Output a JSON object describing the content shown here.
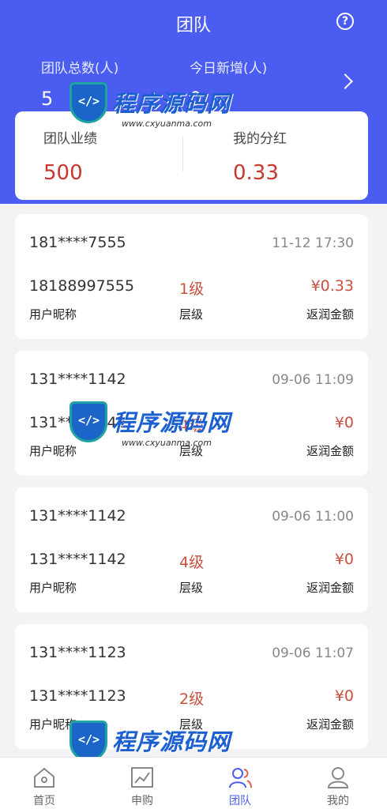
{
  "header": {
    "title": "团队",
    "help_icon": "question-circle-icon"
  },
  "stats": {
    "total_label": "团队总数(人)",
    "total_value": "5",
    "today_label": "今日新增(人)",
    "today_value": "0"
  },
  "summary": {
    "performance_label": "团队业绩",
    "performance_value": "500",
    "dividend_label": "我的分红",
    "dividend_value": "0.33"
  },
  "records": [
    {
      "phone": "181****7555",
      "time": "11-12 17:30",
      "nickname": "18188997555",
      "level": "1级",
      "amount": "¥0.33",
      "nickname_label": "用户昵称",
      "level_label": "层级",
      "amount_label": "返润金额"
    },
    {
      "phone": "131****1142",
      "time": "09-06 11:09",
      "nickname": "131****1142",
      "level": "4级",
      "amount": "¥0",
      "nickname_label": "用户昵称",
      "level_label": "层级",
      "amount_label": "返润金额"
    },
    {
      "phone": "131****1142",
      "time": "09-06 11:00",
      "nickname": "131****1142",
      "level": "4级",
      "amount": "¥0",
      "nickname_label": "用户昵称",
      "level_label": "层级",
      "amount_label": "返润金额"
    },
    {
      "phone": "131****1123",
      "time": "09-06 11:07",
      "nickname": "131****1123",
      "level": "2级",
      "amount": "¥0",
      "nickname_label": "用户昵称",
      "level_label": "层级",
      "amount_label": "返润金额"
    }
  ],
  "tabbar": [
    {
      "label": "首页",
      "icon": "home-icon"
    },
    {
      "label": "申购",
      "icon": "chart-trend-icon"
    },
    {
      "label": "团队",
      "icon": "team-icon",
      "active": true
    },
    {
      "label": "我的",
      "icon": "user-icon"
    }
  ],
  "watermark": {
    "text": "程序源码网",
    "url": "www.cxyuanma.com"
  },
  "colors": {
    "primary": "#4a5df0",
    "accent_red": "#c8372d",
    "background": "#f3f3f5"
  }
}
